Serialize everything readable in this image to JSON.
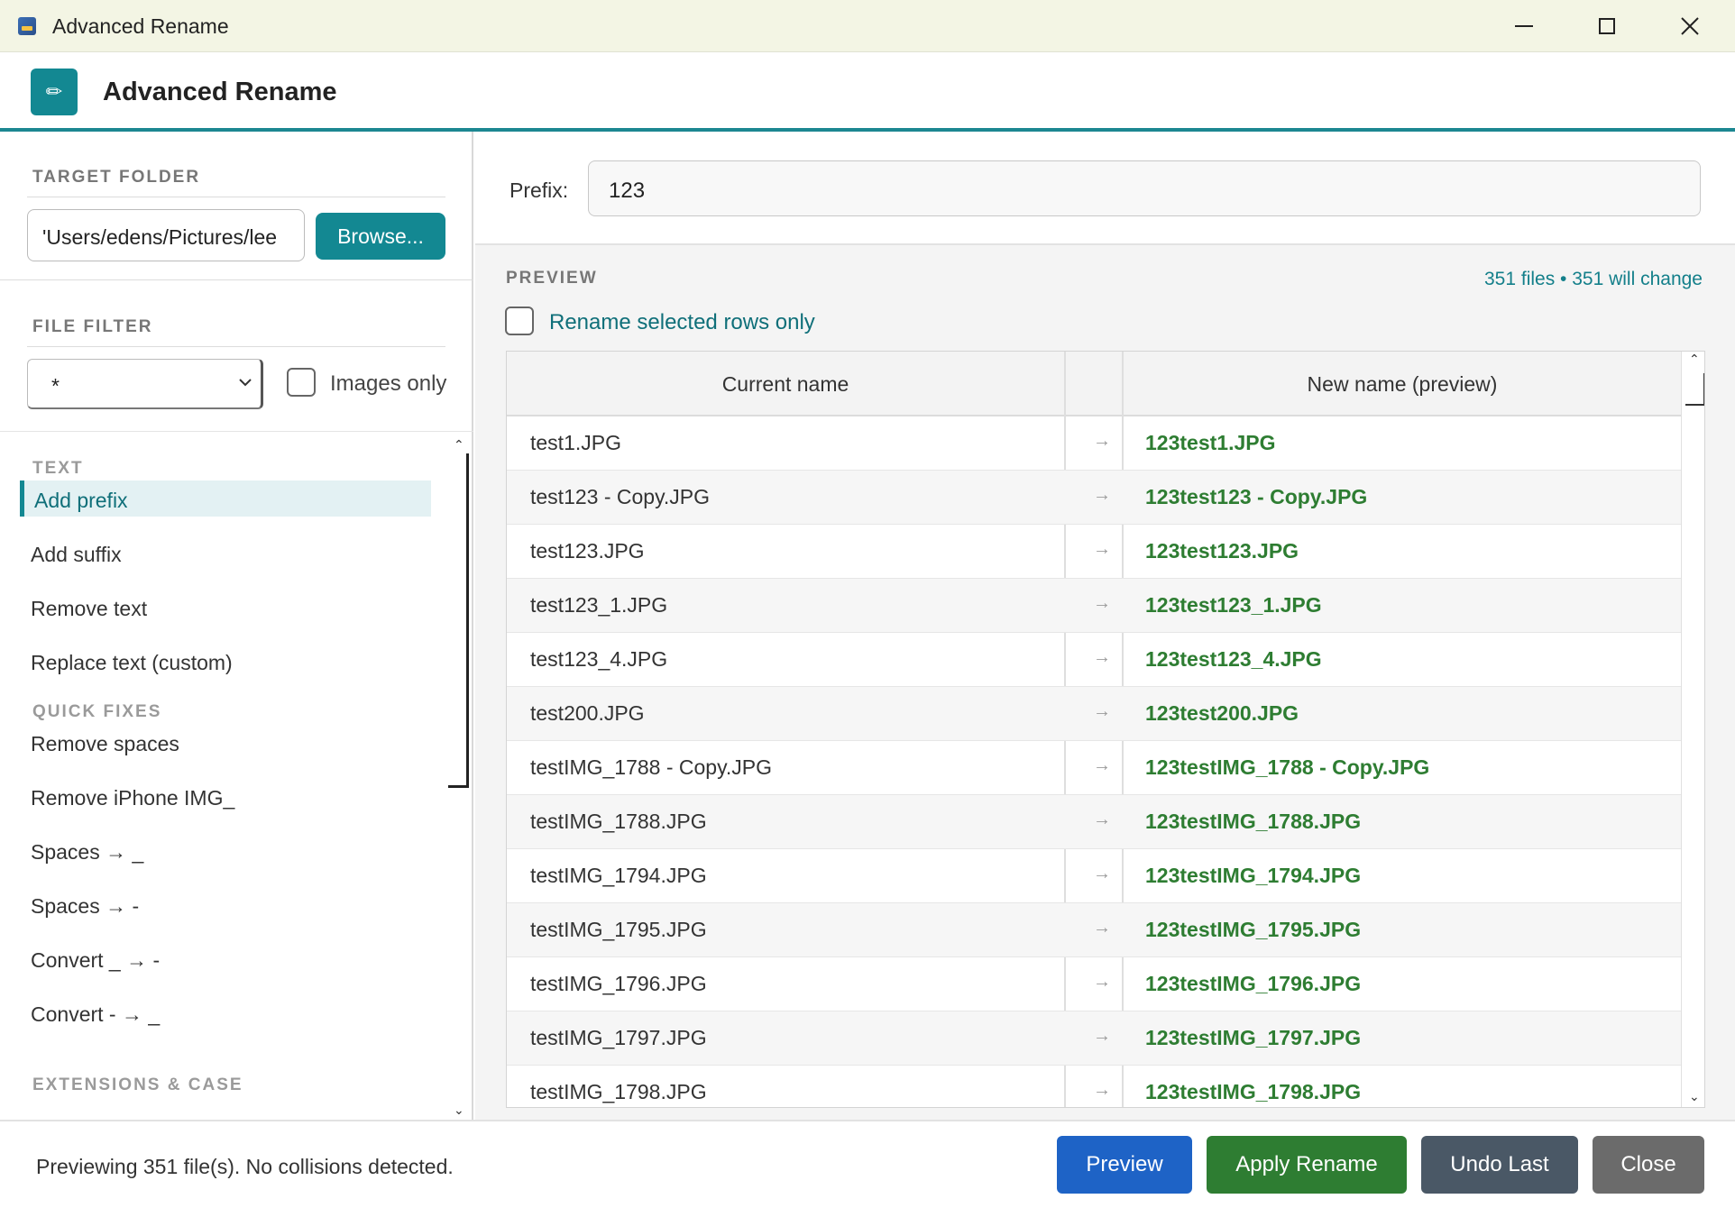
{
  "window": {
    "title": "Advanced Rename"
  },
  "header": {
    "title": "Advanced Rename",
    "logo_icon": "pencil-icon"
  },
  "colors": {
    "accent": "#138892",
    "new_name": "#2e7d32",
    "preview_btn": "#1e63c6",
    "apply_btn": "#2e7d32",
    "undo_btn": "#4a5866",
    "close_btn": "#6b6b6b"
  },
  "left": {
    "target_folder_label": "TARGET FOLDER",
    "folder_value": "'Users/edens/Pictures/lee",
    "browse_label": "Browse...",
    "file_filter_label": "FILE FILTER",
    "filter_value": "*",
    "images_only_label": "Images only",
    "images_only_checked": false,
    "groups": [
      {
        "label": "TEXT",
        "items": [
          "Add prefix",
          "Add suffix",
          "Remove text",
          "Replace text (custom)"
        ]
      },
      {
        "label": "QUICK FIXES",
        "items": [
          "Remove spaces",
          "Remove iPhone IMG_",
          "Spaces → _",
          "Spaces → -",
          "Convert _ → -",
          "Convert - → _"
        ]
      },
      {
        "label": "EXTENSIONS & CASE",
        "items": []
      }
    ],
    "active_item": "Add prefix"
  },
  "prefix": {
    "label": "Prefix:",
    "value": "123"
  },
  "preview": {
    "label": "PREVIEW",
    "stats": "351 files  •  351 will change",
    "rename_selected_label": "Rename selected rows only",
    "rename_selected_checked": false,
    "columns": {
      "current": "Current name",
      "arrow": "",
      "new": "New name (preview)"
    },
    "arrow_glyph": "→",
    "rows": [
      {
        "current": "test1.JPG",
        "new": "123test1.JPG"
      },
      {
        "current": "test123 - Copy.JPG",
        "new": "123test123 - Copy.JPG"
      },
      {
        "current": "test123.JPG",
        "new": "123test123.JPG"
      },
      {
        "current": "test123_1.JPG",
        "new": "123test123_1.JPG"
      },
      {
        "current": "test123_4.JPG",
        "new": "123test123_4.JPG"
      },
      {
        "current": "test200.JPG",
        "new": "123test200.JPG"
      },
      {
        "current": "testIMG_1788 - Copy.JPG",
        "new": "123testIMG_1788 - Copy.JPG"
      },
      {
        "current": "testIMG_1788.JPG",
        "new": "123testIMG_1788.JPG"
      },
      {
        "current": "testIMG_1794.JPG",
        "new": "123testIMG_1794.JPG"
      },
      {
        "current": "testIMG_1795.JPG",
        "new": "123testIMG_1795.JPG"
      },
      {
        "current": "testIMG_1796.JPG",
        "new": "123testIMG_1796.JPG"
      },
      {
        "current": "testIMG_1797.JPG",
        "new": "123testIMG_1797.JPG"
      },
      {
        "current": "testIMG_1798.JPG",
        "new": "123testIMG_1798.JPG"
      }
    ]
  },
  "status": {
    "text": "Previewing 351 file(s). No collisions detected.",
    "buttons": {
      "preview": "Preview",
      "apply": "Apply Rename",
      "undo": "Undo Last",
      "close": "Close"
    }
  }
}
